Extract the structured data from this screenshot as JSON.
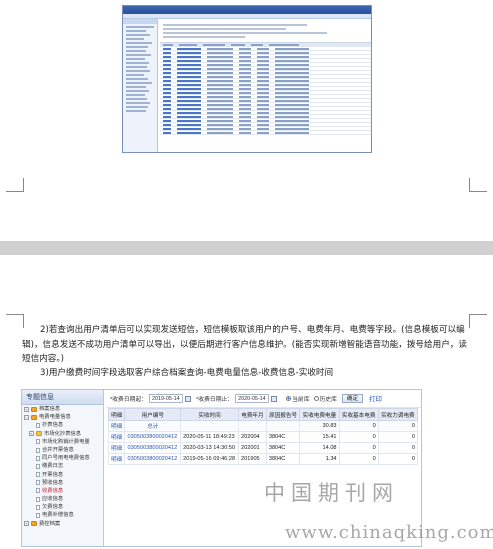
{
  "paragraphs": {
    "p1": "2)若查询出用户清单后可以实现发送短信，短信模板取该用户的户号、电费年月、电费等字段。(信息模板可以编辑)，信息发送不成功用户清单可以导出，以便后期进行客户信息维护。(能否实现新增智能语音功能，拨号给用户，读短信内容。)",
    "p2": "3)用户缴费时间字段选取客户综合档案查询-电费电量信息-收费信息-实收时间"
  },
  "sidebar": {
    "header": "专题信息",
    "items": [
      "档案信息",
      "电费电量信息",
      "抄表信息",
      "市场化抄表信息",
      "市场化购销计费电量",
      "合并开票信息",
      "同户号用电电费信息",
      "缴费日志",
      "开票信息",
      "预收信息",
      "收费信息",
      "应收信息",
      "欠费信息",
      "电费补偿信息",
      "费控档案"
    ]
  },
  "query": {
    "start_label": "*收费日期起：",
    "start_value": "2019-05-14",
    "end_label": "*收费日期止：",
    "end_value": "2020-05-14",
    "radio_current": "当前库",
    "radio_history": "历史库",
    "confirm_button": "确定",
    "print_link": "打印"
  },
  "table": {
    "columns": [
      "明细",
      "用户编号",
      "实收时间",
      "电费年月",
      "原因报告号",
      "实收电费电量",
      "实收基本电费",
      "实收力调电费"
    ],
    "summary": {
      "detail": "明细",
      "user": "总计",
      "amount": "30.83",
      "basic": "0",
      "adjust": "0"
    },
    "rows": [
      {
        "detail": "明细",
        "user": "0305003800020412",
        "time": "2020-05-11 18:49:23",
        "ym": "202004",
        "code": "3804C",
        "amount": "15.41",
        "basic": "0",
        "adjust": "0"
      },
      {
        "detail": "明细",
        "user": "0305003800020412",
        "time": "2020-03-13 14:30:50",
        "ym": "202001",
        "code": "3804C",
        "amount": "14.08",
        "basic": "0",
        "adjust": "0"
      },
      {
        "detail": "明细",
        "user": "0305003800020412",
        "time": "2019-05-16 09:46:28",
        "ym": "201905",
        "code": "3804C",
        "amount": "1.34",
        "basic": "0",
        "adjust": "0"
      }
    ]
  },
  "watermark": {
    "cn": "中国期刊网",
    "url": "www.chinaqking.com"
  }
}
